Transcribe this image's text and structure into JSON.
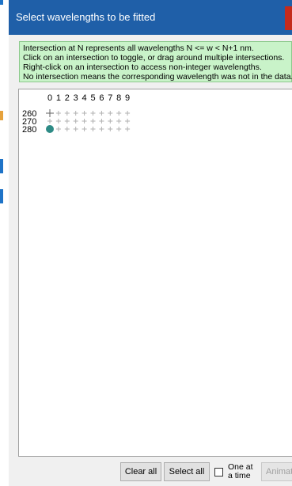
{
  "window": {
    "title": "Select wavelengths to be fitted"
  },
  "info": {
    "lines": [
      "Intersection at N represents all wavelengths N <= w < N+1 nm.",
      "Click on an intersection to toggle, or drag around multiple intersections.",
      "Right-click on an intersection to access non-integer wavelengths.",
      "No intersection means the corresponding wavelength was not in the data."
    ]
  },
  "grid": {
    "column_labels": [
      "0",
      "1",
      "2",
      "3",
      "4",
      "5",
      "6",
      "7",
      "8",
      "9"
    ],
    "row_labels": [
      "260",
      "270",
      "280"
    ],
    "selected": [
      {
        "row": "280",
        "column": "0"
      }
    ],
    "colors": {
      "selected_dot": "#2e8b86",
      "hairline": "#b0b0b0",
      "gridline": "#606060"
    }
  },
  "buttons": {
    "clear_all": "Clear all",
    "select_all": "Select all",
    "one_at_a_time": {
      "label_line1": "One at",
      "label_line2": "a time",
      "checked": false
    },
    "animate": "Animate"
  }
}
